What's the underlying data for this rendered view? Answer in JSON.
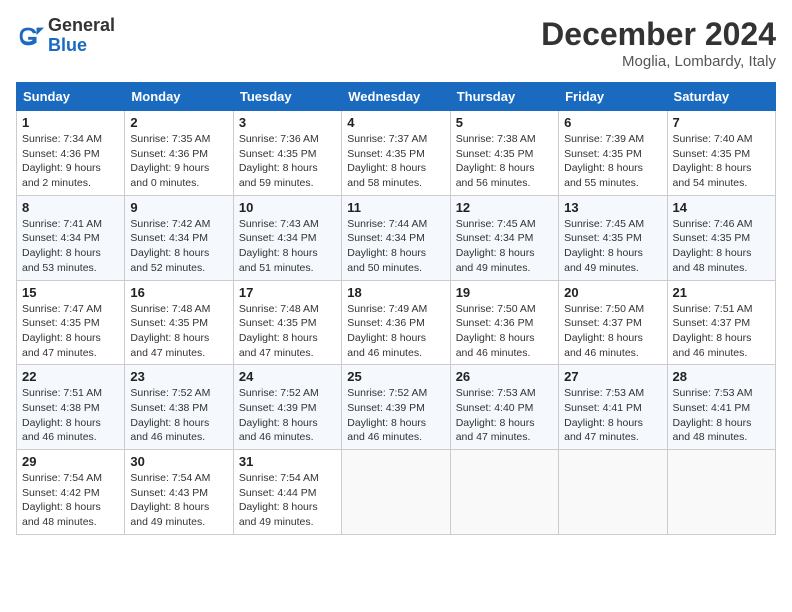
{
  "header": {
    "logo_general": "General",
    "logo_blue": "Blue",
    "month_title": "December 2024",
    "location": "Moglia, Lombardy, Italy"
  },
  "days_of_week": [
    "Sunday",
    "Monday",
    "Tuesday",
    "Wednesday",
    "Thursday",
    "Friday",
    "Saturday"
  ],
  "weeks": [
    [
      {
        "day": "1",
        "sunrise": "7:34 AM",
        "sunset": "4:36 PM",
        "daylight": "9 hours and 2 minutes."
      },
      {
        "day": "2",
        "sunrise": "7:35 AM",
        "sunset": "4:36 PM",
        "daylight": "9 hours and 0 minutes."
      },
      {
        "day": "3",
        "sunrise": "7:36 AM",
        "sunset": "4:35 PM",
        "daylight": "8 hours and 59 minutes."
      },
      {
        "day": "4",
        "sunrise": "7:37 AM",
        "sunset": "4:35 PM",
        "daylight": "8 hours and 58 minutes."
      },
      {
        "day": "5",
        "sunrise": "7:38 AM",
        "sunset": "4:35 PM",
        "daylight": "8 hours and 56 minutes."
      },
      {
        "day": "6",
        "sunrise": "7:39 AM",
        "sunset": "4:35 PM",
        "daylight": "8 hours and 55 minutes."
      },
      {
        "day": "7",
        "sunrise": "7:40 AM",
        "sunset": "4:35 PM",
        "daylight": "8 hours and 54 minutes."
      }
    ],
    [
      {
        "day": "8",
        "sunrise": "7:41 AM",
        "sunset": "4:34 PM",
        "daylight": "8 hours and 53 minutes."
      },
      {
        "day": "9",
        "sunrise": "7:42 AM",
        "sunset": "4:34 PM",
        "daylight": "8 hours and 52 minutes."
      },
      {
        "day": "10",
        "sunrise": "7:43 AM",
        "sunset": "4:34 PM",
        "daylight": "8 hours and 51 minutes."
      },
      {
        "day": "11",
        "sunrise": "7:44 AM",
        "sunset": "4:34 PM",
        "daylight": "8 hours and 50 minutes."
      },
      {
        "day": "12",
        "sunrise": "7:45 AM",
        "sunset": "4:34 PM",
        "daylight": "8 hours and 49 minutes."
      },
      {
        "day": "13",
        "sunrise": "7:45 AM",
        "sunset": "4:35 PM",
        "daylight": "8 hours and 49 minutes."
      },
      {
        "day": "14",
        "sunrise": "7:46 AM",
        "sunset": "4:35 PM",
        "daylight": "8 hours and 48 minutes."
      }
    ],
    [
      {
        "day": "15",
        "sunrise": "7:47 AM",
        "sunset": "4:35 PM",
        "daylight": "8 hours and 47 minutes."
      },
      {
        "day": "16",
        "sunrise": "7:48 AM",
        "sunset": "4:35 PM",
        "daylight": "8 hours and 47 minutes."
      },
      {
        "day": "17",
        "sunrise": "7:48 AM",
        "sunset": "4:35 PM",
        "daylight": "8 hours and 47 minutes."
      },
      {
        "day": "18",
        "sunrise": "7:49 AM",
        "sunset": "4:36 PM",
        "daylight": "8 hours and 46 minutes."
      },
      {
        "day": "19",
        "sunrise": "7:50 AM",
        "sunset": "4:36 PM",
        "daylight": "8 hours and 46 minutes."
      },
      {
        "day": "20",
        "sunrise": "7:50 AM",
        "sunset": "4:37 PM",
        "daylight": "8 hours and 46 minutes."
      },
      {
        "day": "21",
        "sunrise": "7:51 AM",
        "sunset": "4:37 PM",
        "daylight": "8 hours and 46 minutes."
      }
    ],
    [
      {
        "day": "22",
        "sunrise": "7:51 AM",
        "sunset": "4:38 PM",
        "daylight": "8 hours and 46 minutes."
      },
      {
        "day": "23",
        "sunrise": "7:52 AM",
        "sunset": "4:38 PM",
        "daylight": "8 hours and 46 minutes."
      },
      {
        "day": "24",
        "sunrise": "7:52 AM",
        "sunset": "4:39 PM",
        "daylight": "8 hours and 46 minutes."
      },
      {
        "day": "25",
        "sunrise": "7:52 AM",
        "sunset": "4:39 PM",
        "daylight": "8 hours and 46 minutes."
      },
      {
        "day": "26",
        "sunrise": "7:53 AM",
        "sunset": "4:40 PM",
        "daylight": "8 hours and 47 minutes."
      },
      {
        "day": "27",
        "sunrise": "7:53 AM",
        "sunset": "4:41 PM",
        "daylight": "8 hours and 47 minutes."
      },
      {
        "day": "28",
        "sunrise": "7:53 AM",
        "sunset": "4:41 PM",
        "daylight": "8 hours and 48 minutes."
      }
    ],
    [
      {
        "day": "29",
        "sunrise": "7:54 AM",
        "sunset": "4:42 PM",
        "daylight": "8 hours and 48 minutes."
      },
      {
        "day": "30",
        "sunrise": "7:54 AM",
        "sunset": "4:43 PM",
        "daylight": "8 hours and 49 minutes."
      },
      {
        "day": "31",
        "sunrise": "7:54 AM",
        "sunset": "4:44 PM",
        "daylight": "8 hours and 49 minutes."
      },
      null,
      null,
      null,
      null
    ]
  ]
}
